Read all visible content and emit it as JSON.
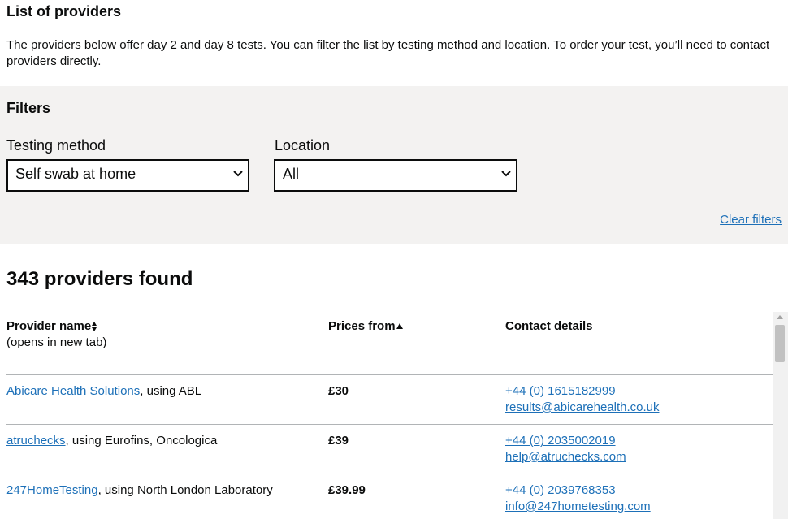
{
  "page": {
    "title": "List of providers",
    "intro": "The providers below offer day 2 and day 8 tests. You can filter the list by testing method and location. To order your test, you’ll need to contact providers directly."
  },
  "filters": {
    "title": "Filters",
    "testing_method": {
      "label": "Testing method",
      "value": "Self swab at home"
    },
    "location": {
      "label": "Location",
      "value": "All"
    },
    "clear_label": "Clear filters"
  },
  "results": {
    "count_text": "343 providers found",
    "headers": {
      "name": "Provider name",
      "name_sub": "(opens in new tab)",
      "price": "Prices from",
      "contact": "Contact details"
    },
    "rows": [
      {
        "name": "Abicare Health Solutions",
        "using": ", using ABL",
        "price": "£30",
        "phone": "+44 (0) 1615182999",
        "email": "results@abicarehealth.co.uk"
      },
      {
        "name": "atruchecks",
        "using": ", using Eurofins, Oncologica",
        "price": "£39",
        "phone": "+44 (0) 2035002019",
        "email": "help@atruchecks.com"
      },
      {
        "name": "247HomeTesting",
        "using": ", using North London Laboratory",
        "price": "£39.99",
        "phone": "+44 (0) 2039768353",
        "email": "info@247hometesting.com"
      }
    ]
  },
  "colors": {
    "link": "#1d70b8",
    "filter_bg": "#f3f2f1",
    "text": "#0b0c0c",
    "border": "#b1b4b6"
  },
  "icons": {
    "sort_name": "sort-both-icon",
    "sort_price": "sort-ascending-icon",
    "select": "chevron-down-icon"
  }
}
